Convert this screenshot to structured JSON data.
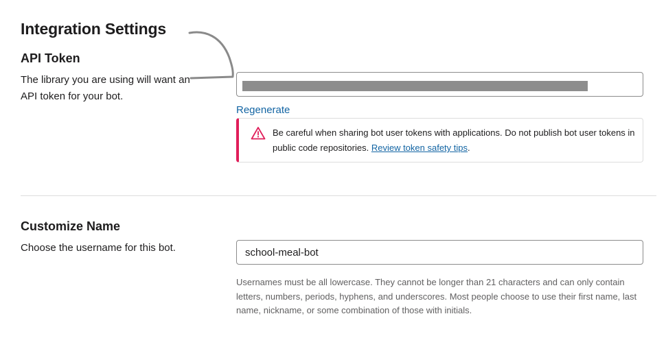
{
  "page": {
    "title": "Integration Settings"
  },
  "api_token": {
    "title": "API Token",
    "description": "The library you are using will want an API token for your bot.",
    "token_value": "",
    "regenerate_label": "Regenerate",
    "warning": {
      "text": "Be careful when sharing bot user tokens with applications. Do not publish bot user tokens in public code repositories.",
      "link_label": "Review token safety tips",
      "trailing": ".",
      "icon": "warning-triangle-icon",
      "accent_color": "#e01e5a"
    }
  },
  "customize_name": {
    "title": "Customize Name",
    "description": "Choose the username for this bot.",
    "username_value": "school-meal-bot",
    "help_text": "Usernames must be all lowercase. They cannot be longer than 21 characters and can only contain letters, numbers, periods, hyphens, and underscores. Most people choose to use their first name, last name, nickname, or some combination of those with initials."
  },
  "colors": {
    "link": "#1264a3",
    "muted_text": "#616061",
    "border": "#8b8b8b"
  }
}
